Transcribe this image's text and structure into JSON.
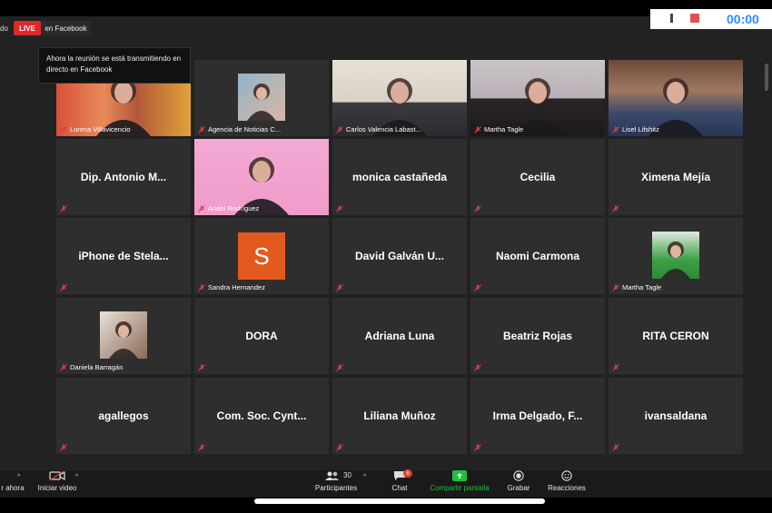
{
  "recording_status": "do",
  "live_badge": "LIVE",
  "live_destination": "en Facebook",
  "live_tooltip": "Ahora la reunión se está transmitiendo en directo en Facebook",
  "timer": "00:00",
  "participants": [
    {
      "name": "Lorena Villavicencio",
      "type": "video",
      "center": ""
    },
    {
      "name": "Agencia de Noticias C...",
      "type": "thumb",
      "center": ""
    },
    {
      "name": "Carlos Valencia Labast...",
      "type": "video",
      "center": ""
    },
    {
      "name": "Martha Tagle",
      "type": "video",
      "center": "",
      "active": true
    },
    {
      "name": "Lisel Lifshitz",
      "type": "video",
      "center": ""
    },
    {
      "name": "",
      "type": "name",
      "center": "Dip. Antonio M..."
    },
    {
      "name": "Anahí Rodríguez",
      "type": "video",
      "center": ""
    },
    {
      "name": "",
      "type": "name",
      "center": "monica castañeda"
    },
    {
      "name": "",
      "type": "name",
      "center": "Cecilia"
    },
    {
      "name": "",
      "type": "name",
      "center": "Ximena Mejía"
    },
    {
      "name": "",
      "type": "name",
      "center": "iPhone de Stela..."
    },
    {
      "name": "Sandra Hernandez",
      "type": "avatar",
      "center": "",
      "initial": "S"
    },
    {
      "name": "",
      "type": "name",
      "center": "David Galván U..."
    },
    {
      "name": "",
      "type": "name",
      "center": "Naomi Carmona"
    },
    {
      "name": "Martha Tagle",
      "type": "thumb",
      "center": ""
    },
    {
      "name": "Daniela Barragán",
      "type": "thumb",
      "center": ""
    },
    {
      "name": "",
      "type": "name",
      "center": "DORA"
    },
    {
      "name": "",
      "type": "name",
      "center": "Adriana Luna"
    },
    {
      "name": "",
      "type": "name",
      "center": "Beatriz Rojas"
    },
    {
      "name": "",
      "type": "name",
      "center": "RITA CERON"
    },
    {
      "name": "",
      "type": "name",
      "center": "agallegos"
    },
    {
      "name": "",
      "type": "name",
      "center": "Com. Soc. Cynt..."
    },
    {
      "name": "",
      "type": "name",
      "center": "Liliana Muñoz"
    },
    {
      "name": "",
      "type": "name",
      "center": "Irma Delgado, F..."
    },
    {
      "name": "",
      "type": "name",
      "center": "ivansaldana"
    }
  ],
  "toolbar": {
    "mute_label": "r ahora",
    "video_label": "Iniciar video",
    "participants_label": "Participantes",
    "participants_count": "30",
    "chat_label": "Chat",
    "chat_badge": "6",
    "share_label": "Compartir pantalla",
    "record_label": "Grabar",
    "reactions_label": "Reacciones"
  },
  "colors": {
    "accent_green": "#1fbf3a",
    "live_red": "#e02828",
    "active_speaker": "#e8e23a",
    "tile_bg": "#2e2e2e"
  }
}
